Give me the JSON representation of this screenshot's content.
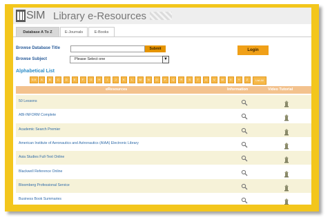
{
  "header": {
    "brand": "SIM",
    "title": "Library e-Resources"
  },
  "tabs": [
    {
      "label": "Database A To Z",
      "active": true
    },
    {
      "label": "E-Journals",
      "active": false
    },
    {
      "label": "E-Books",
      "active": false
    }
  ],
  "browse": {
    "title_label": "Browse Database Title",
    "title_value": "",
    "submit_label": "Submit",
    "subject_label": "Browse Subject",
    "subject_selected": "Please Select one"
  },
  "login_label": "Login",
  "alphabet": {
    "heading": "Alphabetical List",
    "letters": [
      "0-9",
      "A",
      "B",
      "C",
      "D",
      "E",
      "F",
      "G",
      "H",
      "I",
      "J",
      "K",
      "L",
      "M",
      "N",
      "O",
      "P",
      "Q",
      "R",
      "S",
      "T",
      "U",
      "V",
      "W",
      "X",
      "Y",
      "Z"
    ],
    "list_all": "List All"
  },
  "table": {
    "headers": {
      "resource": "eResources",
      "information": "Information",
      "tutorial": "Video Tutorial"
    },
    "rows": [
      "50 Lessons",
      "ABI-INFORM Complete",
      "Academic Search Premier",
      "American Institute of Aeronautics and Astronautics (AIAA) Electronic Library",
      "Asia Studies Full-Text Online",
      "Blackwell Reference Online",
      "Bloomberg Professional Service",
      "Business Book Summaries"
    ]
  },
  "colors": {
    "frame": "#f3c61c",
    "accent": "#f0a018",
    "link": "#2e6aa8",
    "row_alt": "#f6f2d8"
  }
}
